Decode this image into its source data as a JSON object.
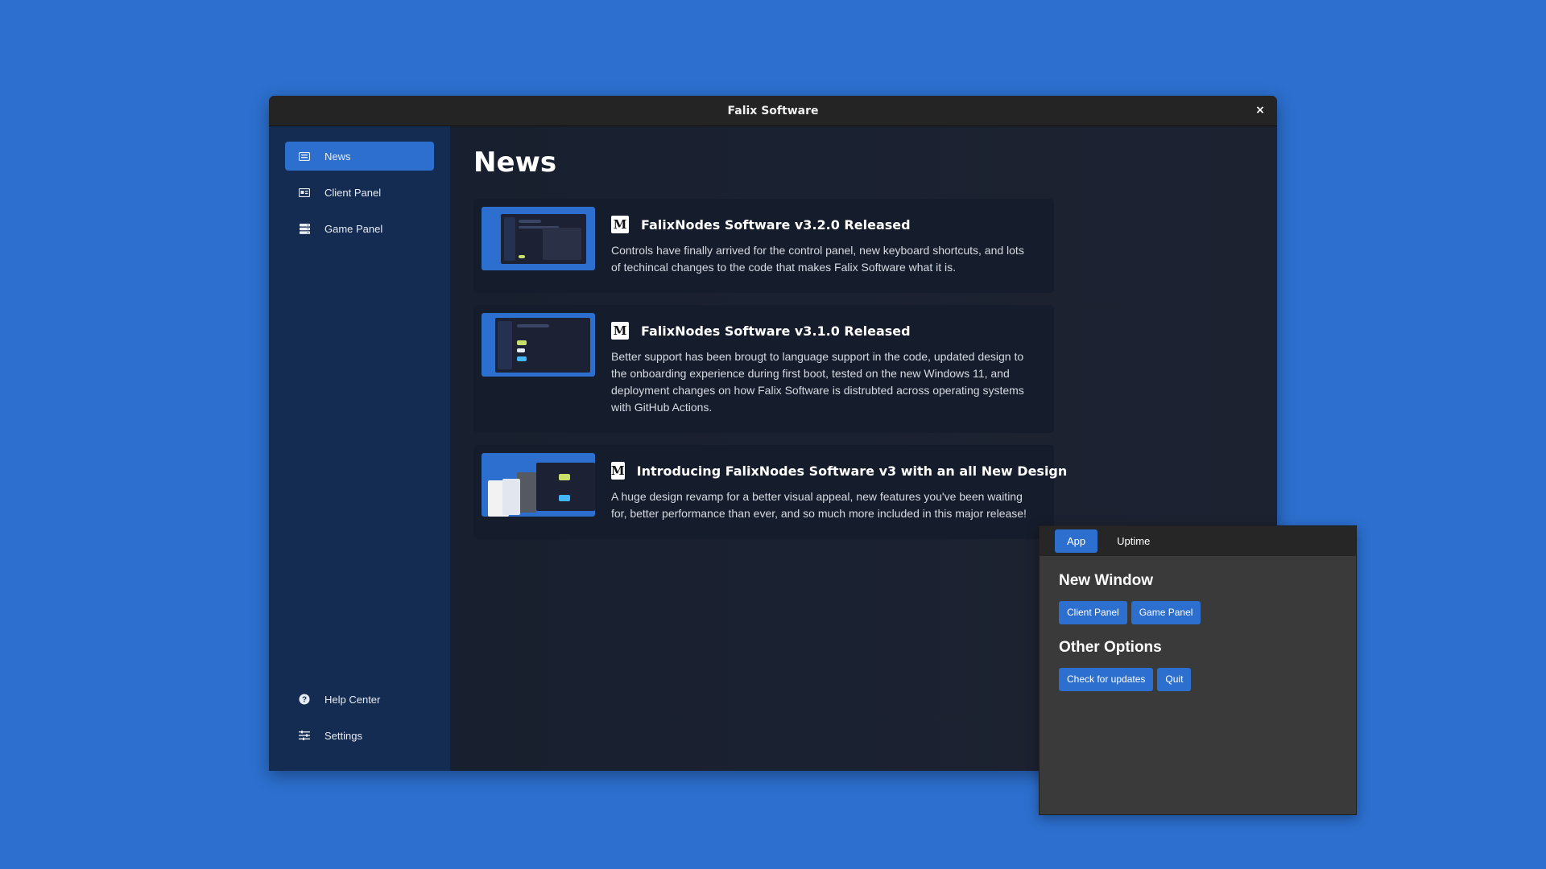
{
  "window": {
    "title": "Falix Software",
    "close_label": "×"
  },
  "sidebar": {
    "items": [
      {
        "label": "News",
        "icon": "news-icon",
        "active": true
      },
      {
        "label": "Client Panel",
        "icon": "client-panel-icon"
      },
      {
        "label": "Game Panel",
        "icon": "game-panel-icon"
      }
    ],
    "bottom_items": [
      {
        "label": "Help Center",
        "icon": "help-circle-icon"
      },
      {
        "label": "Settings",
        "icon": "sliders-icon"
      }
    ]
  },
  "main": {
    "title": "News",
    "news": [
      {
        "source_icon": "medium-icon",
        "source_glyph": "M",
        "title": "FalixNodes Software v3.2.0 Released",
        "description": "Controls have finally arrived for the control panel, new keyboard shortcuts, and lots of techincal changes to the code that makes Falix Software what it is."
      },
      {
        "source_icon": "medium-icon",
        "source_glyph": "M",
        "title": "FalixNodes Software v3.1.0 Released",
        "description": "Better support has been brougt to language support in the code, updated design to the onboarding experience during first boot, tested on the new Windows 11, and deployment changes on how Falix Software is distrubted across operating systems with GitHub Actions."
      },
      {
        "source_icon": "medium-icon",
        "source_glyph": "M",
        "title": "Introducing FalixNodes Software v3 with an all New Design",
        "description": "A huge design revamp for a better visual appeal, new features you've been waiting for, better performance than ever, and so much more included in this major release!"
      }
    ]
  },
  "panel": {
    "tabs": [
      {
        "label": "App",
        "active": true
      },
      {
        "label": "Uptime"
      }
    ],
    "new_window_heading": "New Window",
    "new_window_buttons": [
      "Client Panel",
      "Game Panel"
    ],
    "other_options_heading": "Other Options",
    "other_options_buttons": [
      "Check for updates",
      "Quit"
    ]
  },
  "colors": {
    "desktop": "#2c6fce",
    "accent": "#2c6fce",
    "sidebar": "#142b52",
    "content": "#1b2232",
    "card": "#151c2b",
    "panel": "#3a3a3a",
    "titlebar": "#242424"
  }
}
